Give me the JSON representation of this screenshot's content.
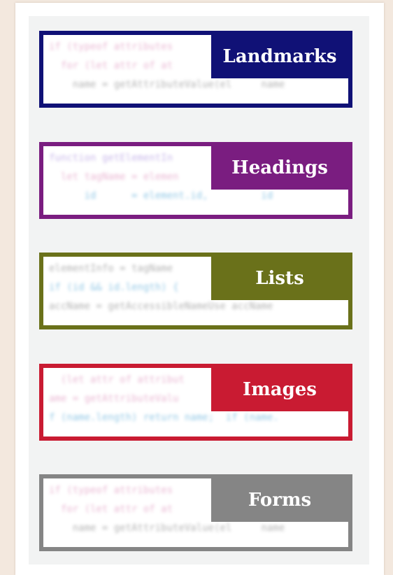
{
  "cards": [
    {
      "label": "Landmarks",
      "color": "#101176",
      "code": [
        "if (typeof attributes",
        "  for (let attr of at",
        "    name = getAttributeValue(el     name"
      ]
    },
    {
      "label": "Headings",
      "color": "#7a1d80",
      "code": [
        "function getElementIn",
        "  let tagName = elemen",
        "      id      = element.id,         id"
      ]
    },
    {
      "label": "Lists",
      "color": "#6a711a",
      "code": [
        "elementInfo = tagName",
        "if (id && id.length) {",
        "accName = getAccessibleNameUse accName"
      ]
    },
    {
      "label": "Images",
      "color": "#c91b32",
      "code": [
        "  (let attr of attribut",
        "ame = getAttributeValu",
        "f (name.length) return name;  if (name."
      ]
    },
    {
      "label": "Forms",
      "color": "#858585",
      "code": [
        "if (typeof attributes",
        "  for (let attr of at",
        "    name = getAttributeValue(el     name"
      ]
    }
  ]
}
